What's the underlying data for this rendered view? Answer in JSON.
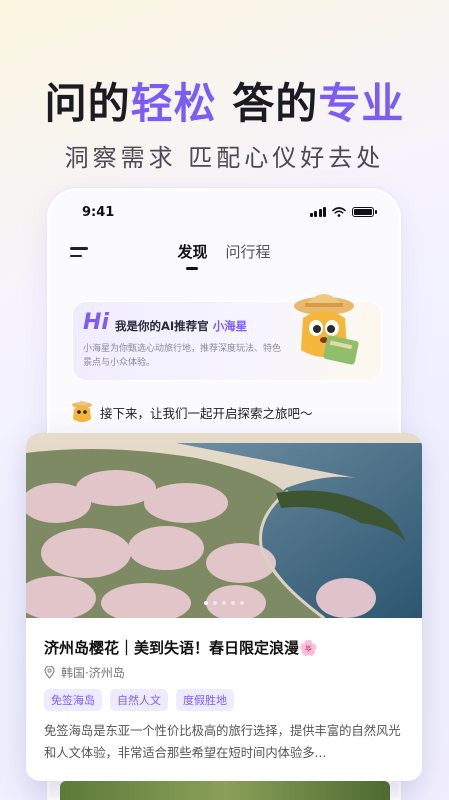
{
  "hero": {
    "title_part1": "问的",
    "title_part2": "轻松",
    "title_part3": " 答的",
    "title_part4": "专业",
    "subtitle": "洞察需求 匹配心仪好去处"
  },
  "status_bar": {
    "time": "9:41"
  },
  "nav": {
    "tabs": [
      {
        "label": "发现",
        "active": true
      },
      {
        "label": "问行程",
        "active": false
      }
    ]
  },
  "ai_card": {
    "hi": "Hi",
    "headline": "我是你的AI推荐官",
    "name": "小海星",
    "description": "小海星为你甄选心动旅行地，推荐深度玩法、特色景点与小众体验。"
  },
  "prompt": {
    "text": "接下来，让我们一起开启探索之旅吧～"
  },
  "feed_card": {
    "title": "济州岛樱花｜美到失语！春日限定浪漫🌸",
    "location": "韩国·济州岛",
    "tags": [
      "免签海岛",
      "自然人文",
      "度假胜地"
    ],
    "body": "免签海岛是东亚一个性价比极高的旅行选择，提供丰富的自然风光和人文体验，非常适合那些希望在短时间内体验多...",
    "carousel": {
      "total": 5,
      "active_index": 0
    }
  },
  "icons": {
    "menu": "menu-icon",
    "pin": "location-pin-icon",
    "signal": "signal-icon",
    "wifi": "wifi-icon",
    "battery": "battery-icon"
  },
  "colors": {
    "accent": "#7c5cf5",
    "tag_bg": "#efebff"
  }
}
